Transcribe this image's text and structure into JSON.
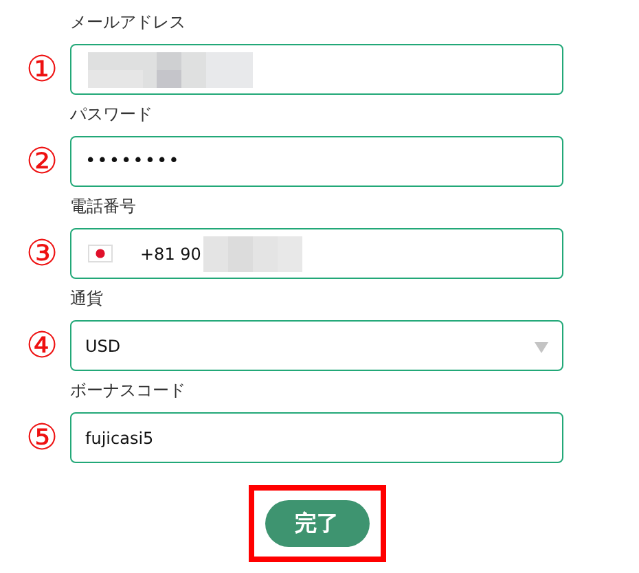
{
  "fields": [
    {
      "kind": "text",
      "marker": "①",
      "label": "メールアドレス",
      "redacted": true
    },
    {
      "kind": "password",
      "marker": "②",
      "label": "パスワード",
      "value": "••••••••"
    },
    {
      "kind": "phone",
      "marker": "③",
      "label": "電話番号",
      "value": "+81 90",
      "redacted": true
    },
    {
      "kind": "select",
      "marker": "④",
      "label": "通貨",
      "value": "USD"
    },
    {
      "kind": "text",
      "marker": "⑤",
      "label": "ボーナスコード",
      "value": "fujicasi5"
    }
  ],
  "submit": {
    "label": "完了",
    "highlighted": true
  }
}
